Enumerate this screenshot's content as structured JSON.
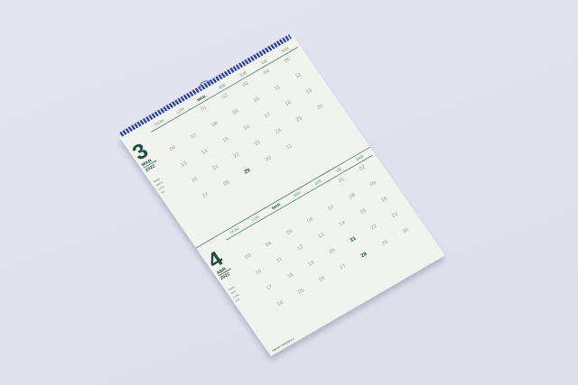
{
  "weekdays": [
    "DOM",
    "LUN",
    "MAR",
    "MIE",
    "JUE",
    "VIE",
    "SAB"
  ],
  "months": [
    {
      "number": "3",
      "name": "MAR",
      "year": "2022",
      "notes": [
        "Notas",
        "Marzo",
        "Luna",
        "Sol"
      ],
      "weeks": [
        [
          "",
          "",
          "01",
          "02",
          "03",
          "04",
          "05"
        ],
        [
          "06",
          "07",
          "08",
          "09",
          "10",
          "11",
          "12"
        ],
        [
          "13",
          "14",
          "15",
          "16",
          "17",
          "18",
          "19"
        ],
        [
          "20",
          "21",
          "22",
          "23",
          "24",
          "25",
          "26"
        ],
        [
          "27",
          "28",
          "29",
          "30",
          "31",
          "",
          ""
        ]
      ],
      "highlight": [
        "29"
      ]
    },
    {
      "number": "4",
      "name": "ABR",
      "year": "2022",
      "notes": [
        "Notas",
        "Abril",
        "Luna",
        "Sol"
      ],
      "weeks": [
        [
          "",
          "",
          "",
          "",
          "",
          "01",
          "02"
        ],
        [
          "03",
          "04",
          "05",
          "06",
          "07",
          "08",
          "09"
        ],
        [
          "10",
          "11",
          "12",
          "13",
          "14",
          "15",
          "16"
        ],
        [
          "17",
          "18",
          "19",
          "20",
          "21",
          "22",
          "23"
        ],
        [
          "24",
          "25",
          "26",
          "27",
          "28",
          "29",
          "30"
        ]
      ],
      "highlight": [
        "21",
        "28"
      ]
    }
  ],
  "footer": "Agenda Calendario 1",
  "colors": {
    "accent": "#1f4c41",
    "spiral": "#2b3f9e"
  }
}
